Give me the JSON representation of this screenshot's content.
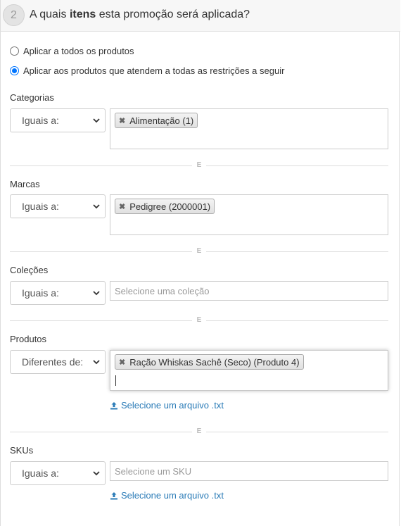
{
  "header": {
    "step_number": "2",
    "title_prefix": "A quais ",
    "title_bold": "itens",
    "title_suffix": " esta promoção será aplicada?"
  },
  "options": {
    "apply_all_label": "Aplicar a todos os produtos",
    "apply_restricted_label": "Aplicar aos produtos que atendem a todas as restrições a seguir",
    "selected": "apply_restricted"
  },
  "separator_label": "E",
  "categorias": {
    "label": "Categorias",
    "operator": "Iguais a:",
    "tags": [
      "Alimentação (1)"
    ]
  },
  "marcas": {
    "label": "Marcas",
    "operator": "Iguais a:",
    "tags": [
      "Pedigree (2000001)"
    ]
  },
  "colecoes": {
    "label": "Coleções",
    "operator": "Iguais a:",
    "placeholder": "Selecione uma coleção"
  },
  "produtos": {
    "label": "Produtos",
    "operator": "Diferentes de:",
    "tags": [
      "Ração Whiskas Sachê (Seco) (Produto 4)"
    ],
    "upload_label": "Selecione um arquivo .txt"
  },
  "skus": {
    "label": "SKUs",
    "operator": "Iguais a:",
    "placeholder": "Selecione um SKU",
    "upload_label": "Selecione um arquivo .txt"
  },
  "colors": {
    "link": "#2a7bb7",
    "radio_checked": "#0075ff"
  }
}
